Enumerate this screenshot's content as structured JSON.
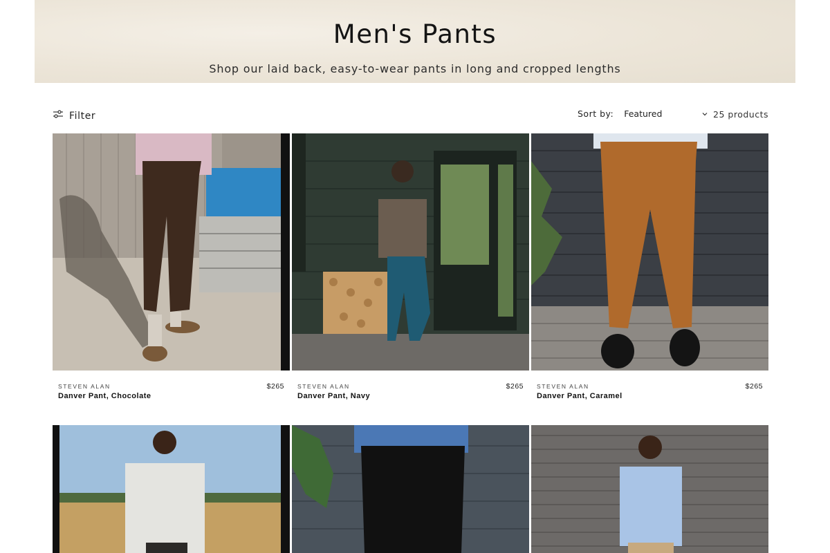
{
  "hero": {
    "title": "Men's Pants",
    "subtitle": "Shop our laid back, easy-to-wear pants in long and cropped lengths"
  },
  "toolbar": {
    "filter_label": "Filter",
    "filter_icon": "sliders-icon",
    "sort_label": "Sort by:",
    "sort_value": "Featured",
    "sort_icon": "chevron-down-icon",
    "product_count": "25 products"
  },
  "products": [
    {
      "brand": "STEVEN ALAN",
      "name": "Danver Pant, Chocolate",
      "price": "$265",
      "pant_color": "#3e2a1e"
    },
    {
      "brand": "STEVEN ALAN",
      "name": "Danver Pant, Navy",
      "price": "$265",
      "pant_color": "#1f5b73"
    },
    {
      "brand": "STEVEN ALAN",
      "name": "Danver Pant, Caramel",
      "price": "$265",
      "pant_color": "#b06a2c"
    }
  ],
  "products_row2": [
    {
      "pant_color": "#2c2a28"
    },
    {
      "pant_color": "#111111"
    },
    {
      "pant_color": "#c7a97f"
    }
  ]
}
